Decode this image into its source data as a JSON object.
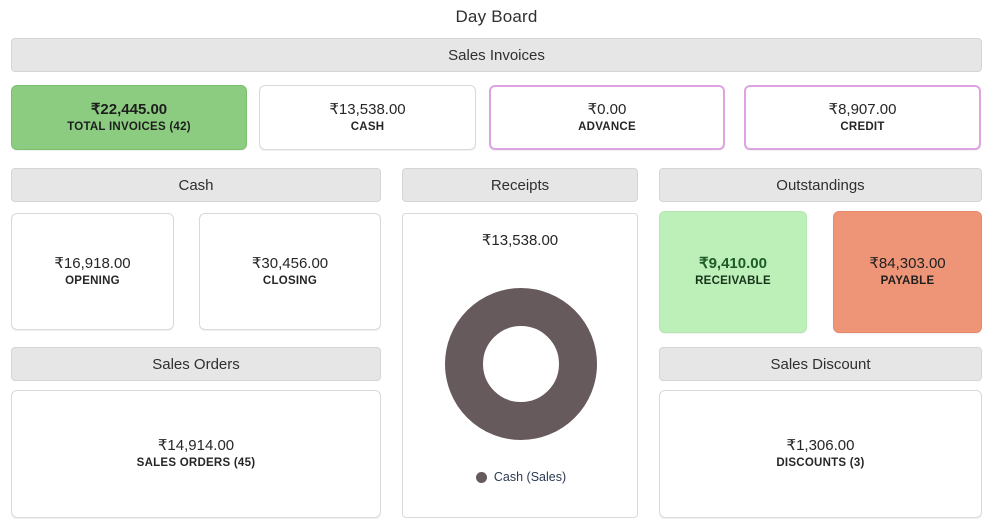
{
  "page": {
    "title": "Day Board"
  },
  "sections": {
    "sales_invoices": {
      "title": "Sales Invoices"
    },
    "cash": {
      "title": "Cash"
    },
    "receipts": {
      "title": "Receipts"
    },
    "outstandings": {
      "title": "Outstandings"
    },
    "sales_orders": {
      "title": "Sales Orders"
    },
    "sales_discount": {
      "title": "Sales Discount"
    }
  },
  "cards": {
    "total_invoices": {
      "amount": "₹22,445.00",
      "label": "TOTAL INVOICES (42)"
    },
    "cash": {
      "amount": "₹13,538.00",
      "label": "CASH"
    },
    "advance": {
      "amount": "₹0.00",
      "label": "ADVANCE"
    },
    "credit": {
      "amount": "₹8,907.00",
      "label": "CREDIT"
    },
    "opening": {
      "amount": "₹16,918.00",
      "label": "OPENING"
    },
    "closing": {
      "amount": "₹30,456.00",
      "label": "CLOSING"
    },
    "receivable": {
      "amount": "₹9,410.00",
      "label": "RECEIVABLE"
    },
    "payable": {
      "amount": "₹84,303.00",
      "label": "PAYABLE"
    },
    "sales_orders": {
      "amount": "₹14,914.00",
      "label": "SALES ORDERS (45)"
    },
    "discounts": {
      "amount": "₹1,306.00",
      "label": "DISCOUNTS (3)"
    }
  },
  "receipts": {
    "total": "₹13,538.00",
    "legend_label": "Cash (Sales)"
  },
  "colors": {
    "header_bar": "#e6e6e6",
    "highlight_green": "#8bcc80",
    "soft_green": "#bdefb9",
    "soft_orange": "#ee9578",
    "outline_purple": "#dda4e2",
    "donut_segment": "#665a5c",
    "card_border": "#d9d9d9",
    "text": "#262626"
  },
  "chart_data": {
    "type": "pie",
    "title": "Receipts",
    "subtitle": "₹13,538.00",
    "categories": [
      "Cash (Sales)"
    ],
    "values": [
      13538
    ],
    "value_labels": [
      "₹13,538.00"
    ],
    "percentages": [
      100
    ],
    "colors": [
      "#665a5c"
    ],
    "legend": [
      "Cash (Sales)"
    ],
    "legend_position": "bottom",
    "donut": true,
    "inner_radius_ratio": 0.52,
    "grid": false,
    "xlabel": "",
    "ylabel": ""
  }
}
